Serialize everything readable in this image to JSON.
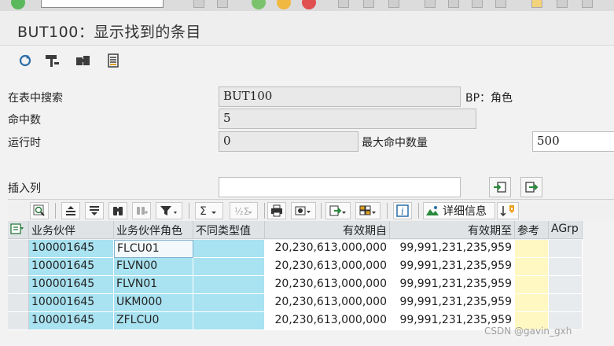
{
  "title": "BUT100：显示找到的条目",
  "form": {
    "search_table_label": "在表中搜索",
    "search_table_value": "BUT100",
    "search_table_desc": "BP：角色",
    "hits_label": "命中数",
    "hits_value": "5",
    "runtime_label": "运行时",
    "runtime_value": "0",
    "max_hits_label": "最大命中数量",
    "max_hits_value": "500",
    "insert_col_label": "插入列",
    "insert_col_value": ""
  },
  "alv_toolbar": {
    "details_label": "详细信息"
  },
  "grid": {
    "headers": [
      "业务伙伴",
      "业务伙伴角色",
      "不同类型值",
      "有效期自",
      "有效期至",
      "参考",
      "AGrp"
    ],
    "rows": [
      [
        "100001645",
        "FLCU01",
        "",
        "20,230,613,000,000",
        "99,991,231,235,959",
        "",
        ""
      ],
      [
        "100001645",
        "FLVN00",
        "",
        "20,230,613,000,000",
        "99,991,231,235,959",
        "",
        ""
      ],
      [
        "100001645",
        "FLVN01",
        "",
        "20,230,613,000,000",
        "99,991,231,235,959",
        "",
        ""
      ],
      [
        "100001645",
        "UKM000",
        "",
        "20,230,613,000,000",
        "99,991,231,235,959",
        "",
        ""
      ],
      [
        "100001645",
        "ZFLCU0",
        "",
        "20,230,613,000,000",
        "99,991,231,235,959",
        "",
        ""
      ]
    ]
  },
  "watermark": "CSDN @gavin_gxh"
}
